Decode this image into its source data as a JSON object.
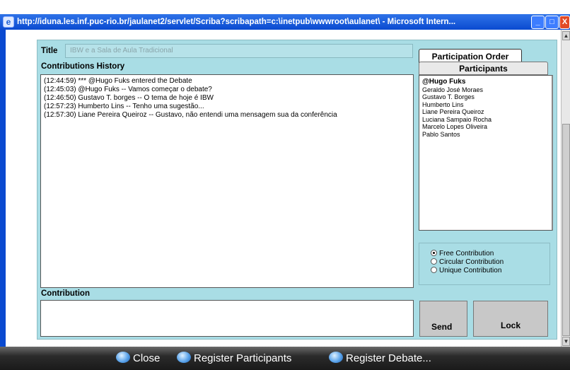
{
  "window": {
    "title": "http://iduna.les.inf.puc-rio.br/jaulanet2/servlet/Scriba?scribapath=c:\\inetpub\\wwwroot\\aulanet\\ - Microsoft Intern...",
    "minimize": "_",
    "maximize": "□",
    "close": "X"
  },
  "form": {
    "title_label": "Title",
    "title_value": "IBW e a Sala de Aula Tradicional",
    "history_label": "Contributions History",
    "history": [
      "(12:44:59) *** @Hugo Fuks entered the Debate",
      "(12:45:03) @Hugo Fuks -- Vamos começar o debate?",
      "(12:46:50) Gustavo T. borges -- O tema de hoje é IBW",
      "(12:57:23) Humberto Lins -- Tenho uma sugestão...",
      "(12:57:30) Liane Pereira Queiroz -- Gustavo, não entendi uma mensagem sua da conferência"
    ],
    "contribution_label": "Contribution",
    "contribution_value": ""
  },
  "tabs": {
    "order": "Participation Order",
    "participants": "Participants"
  },
  "participants": [
    "@Hugo Fuks",
    "Geraldo José Moraes",
    "Gustavo T. Borges",
    "Humberto Lins",
    "Liane Pereira Queiroz",
    "Luciana Sampaio Rocha",
    "Marcelo Lopes Oliveira",
    "Pablo Santos"
  ],
  "modes": [
    {
      "label": "Free Contribution",
      "selected": true
    },
    {
      "label": "Circular Contribution",
      "selected": false
    },
    {
      "label": "Unique Contribution",
      "selected": false
    }
  ],
  "buttons": {
    "send": "Send",
    "lock": "Lock"
  },
  "bottom_nav": {
    "close": "Close",
    "register_participants": "Register Participants",
    "register_debate": "Register Debate..."
  },
  "colors": {
    "panel": "#a9dde5",
    "titlebar": "#0a4ad0",
    "bottombar": "#1a1a1a"
  }
}
